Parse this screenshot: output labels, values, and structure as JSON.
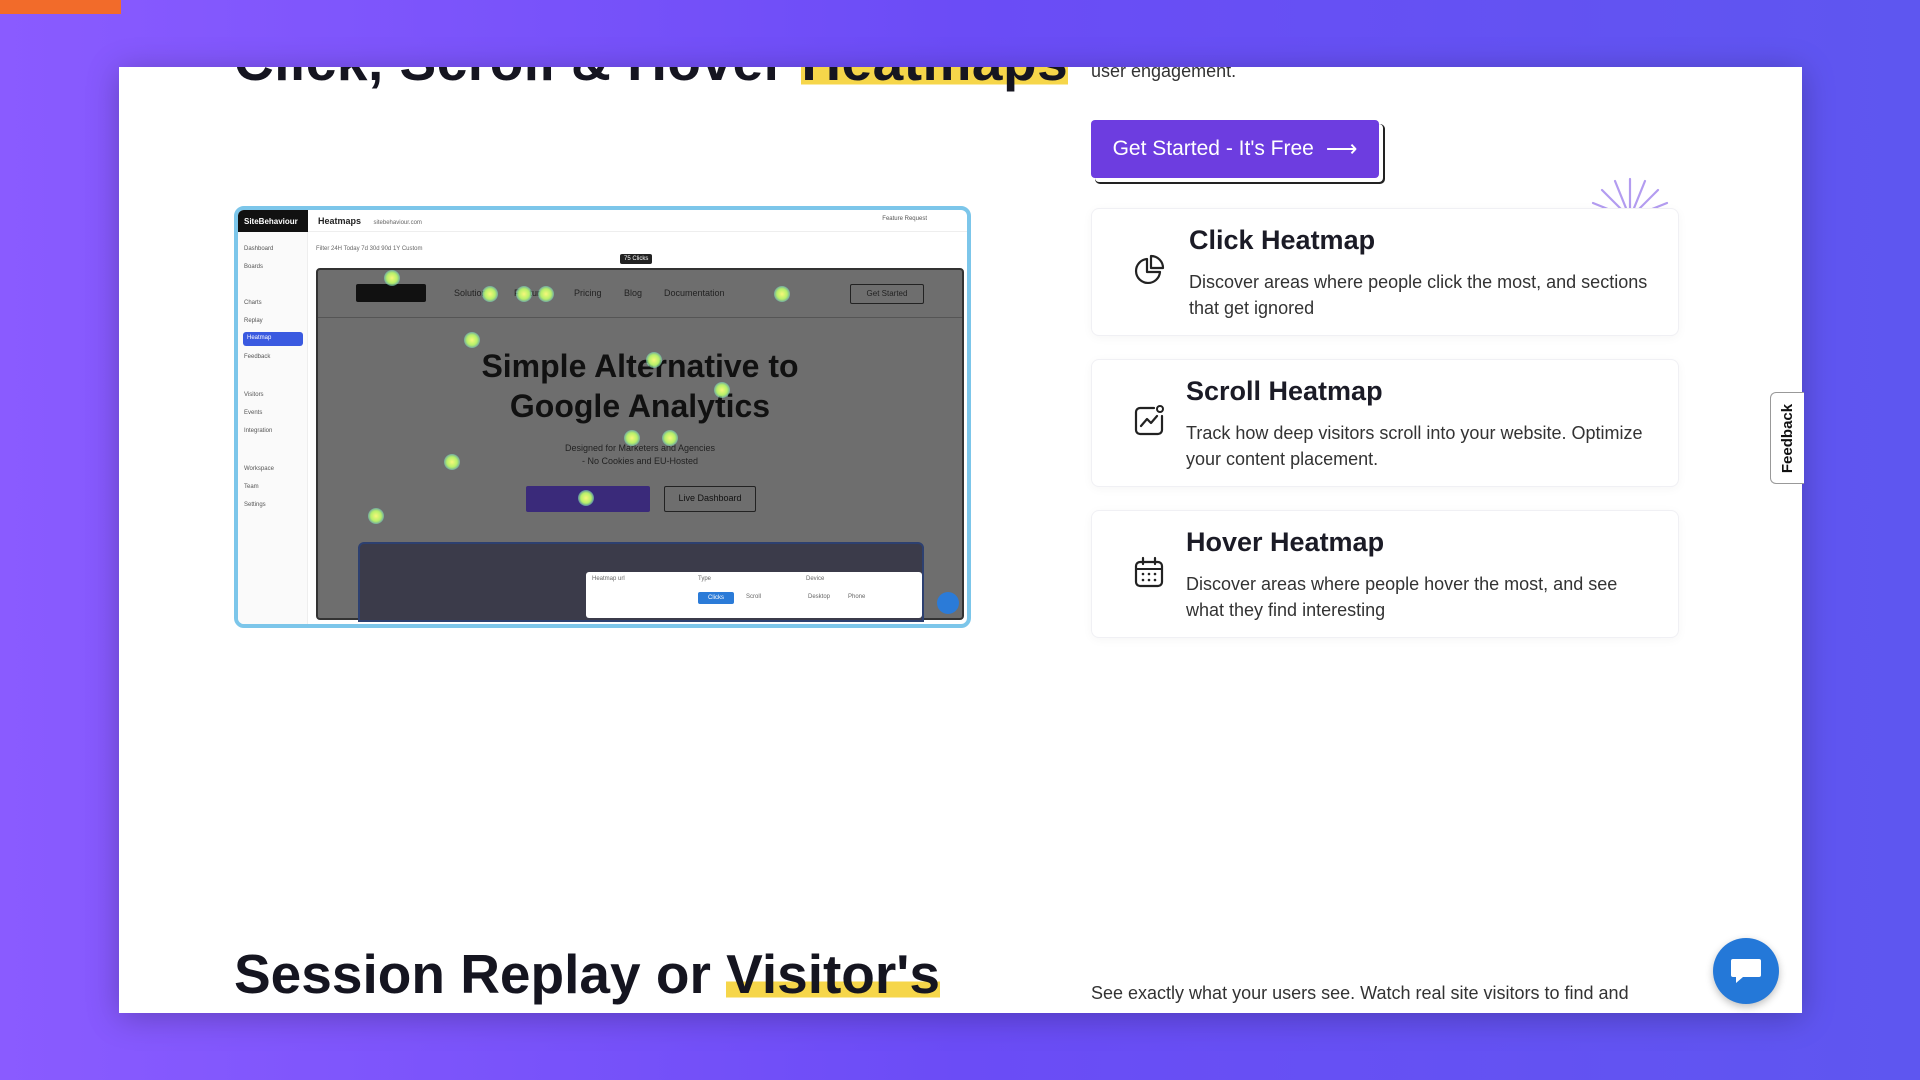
{
  "top_section": {
    "heading_prefix": "Click, Scroll & Hover ",
    "heading_highlight": "Heatmaps",
    "subtext": "user engagement.",
    "cta_label": "Get Started - It's Free",
    "cta_arrow": "⟶"
  },
  "cards": [
    {
      "title": "Click Heatmap",
      "description": "Discover areas where people click the most, and sections that get ignored",
      "icon": "pie-chart-icon"
    },
    {
      "title": "Scroll Heatmap",
      "description": "Track how deep visitors scroll into your website. Optimize your content placement.",
      "icon": "trend-chart-icon"
    },
    {
      "title": "Hover Heatmap",
      "description": "Discover areas where people hover the most, and see what they find interesting",
      "icon": "calendar-icon"
    }
  ],
  "screenshot": {
    "brand": "SiteBehaviour",
    "page_title": "Heatmaps",
    "domain_pill": "sitebehaviour.com",
    "feature_request": "Feature Request",
    "sidebar": [
      "Dashboard",
      "Boards",
      "Charts",
      "Replay",
      "Heatmap",
      "Feedback",
      "Visitors",
      "Events",
      "Integration",
      "Workspace",
      "Team",
      "Settings"
    ],
    "filter": "Filter   24H   Today   7d   30d   90d   1Y   Custom",
    "tooltip": "75 Clicks",
    "nav_links": [
      "Solutions",
      "Features",
      "Pricing",
      "Blog",
      "Documentation"
    ],
    "nav_button": "Get Started",
    "hero_title_line1": "Simple Alternative to",
    "hero_title_line2": "Google Analytics",
    "hero_sub_line1": "Designed for Marketers and Agencies",
    "hero_sub_line2": "- No Cookies and EU-Hosted",
    "hero_button": "Live Dashboard",
    "popup_labels": [
      "Heatmap url",
      "Type",
      "Device",
      "Clicks",
      "Scroll",
      "Desktop",
      "Phone"
    ]
  },
  "bottom_section": {
    "heading_prefix": "Session Replay or ",
    "heading_highlight": "Visitor's",
    "subtext": "See exactly what your users see. Watch real site visitors to find and"
  },
  "feedback_tab": "Feedback",
  "colors": {
    "accent": "#6d3de0",
    "highlight": "#f6d64a",
    "chat": "#2478d8",
    "background": "#6b4cf6"
  }
}
